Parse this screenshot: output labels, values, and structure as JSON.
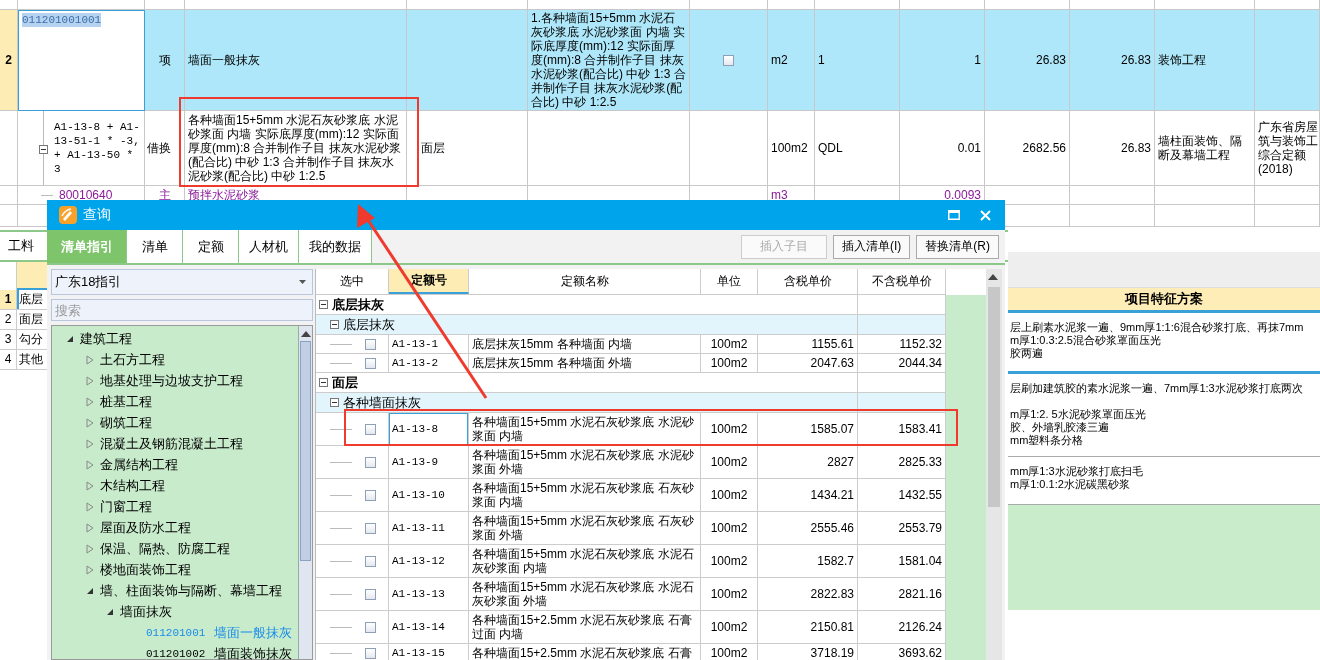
{
  "grid": {
    "rows": [
      {
        "kind": "item",
        "number": "2",
        "selected": true,
        "code": "011201001001",
        "type": "项",
        "name": "墙面一般抹灰",
        "description": "1.各种墙面15+5mm 水泥石灰砂浆底 水泥砂浆面 内墙 实际底厚度(mm):12 实际面厚度(mm):8 合并制作子目 抹灰水泥砂浆(配合比) 中砂 1:3 合并制作子目 抹灰水泥砂浆(配合比) 中砂 1:2.5",
        "checked": false,
        "unit": "m2",
        "quantity_expression": "1",
        "quantity": "1",
        "unit_price": "26.83",
        "total": "26.83",
        "category": "装饰工程"
      },
      {
        "kind": "sub",
        "expanded": true,
        "code": "A1-13-8 + A1-13-51-1 * -3,+ A1-13-50 * 3",
        "type": "借换",
        "name": "各种墙面15+5mm 水泥石灰砂浆底 水泥砂浆面 内墙 实际底厚度(mm):12 实际面厚度(mm):8 合并制作子目 抹灰水泥砂浆(配合比) 中砂 1:3 合并制作子目 抹灰水泥砂浆(配合比) 中砂 1:2.5",
        "column_5": "面层",
        "unit": "100m2",
        "quantity_expression": "QDL",
        "quantity": "0.01",
        "unit_price": "2682.56",
        "total": "26.83",
        "category": "墙柱面装饰、隔断及幕墙工程",
        "source_lines": [
          "广东省房屋",
          "筑与装饰工",
          "综合定额",
          "(2018)"
        ]
      },
      {
        "kind": "material",
        "code": "80010640",
        "type": "主",
        "name": "预拌水泥砂浆",
        "unit": "m3",
        "quantity": "0.0093"
      }
    ]
  },
  "lower_panel": {
    "tab": "工料",
    "rows": [
      {
        "number": "1",
        "name": "底层",
        "selected": true
      },
      {
        "number": "2",
        "name": "面层",
        "selected": false
      },
      {
        "number": "3",
        "name": "勾分",
        "selected": false
      },
      {
        "number": "4",
        "name": "其他",
        "selected": false
      }
    ]
  },
  "feature_panel": {
    "title": "项目特征方案",
    "sections": [
      {
        "lines": [
          "层上刷素水泥浆一遍、9mm厚1:1:6混合砂浆打底、再抹7mm",
          "m厚1:0.3:2.5混合砂浆罩面压光",
          "胶两遍"
        ]
      },
      {
        "lines": [
          "层刷加建筑胶的素水泥浆一遍、7mm厚1:3水泥砂浆打底两次",
          "m厚1:2. 5水泥砂浆罩面压光",
          "胶、外墙乳胶漆三遍",
          "mm塑料条分格"
        ]
      },
      {
        "lines": [
          "mm厚1:3水泥砂浆打底扫毛",
          "m厚1:0.1:2水泥碳黑砂浆"
        ]
      }
    ]
  },
  "dialog": {
    "title": "查询",
    "tabs": [
      {
        "label": "清单指引",
        "selected": true
      },
      {
        "label": "清单",
        "selected": false
      },
      {
        "label": "定额",
        "selected": false
      },
      {
        "label": "人材机",
        "selected": false
      },
      {
        "label": "我的数据",
        "selected": false
      }
    ],
    "buttons": [
      {
        "label": "插入子目",
        "disabled": true
      },
      {
        "label": "插入清单(I)",
        "disabled": false
      },
      {
        "label": "替换清单(R)",
        "disabled": false
      }
    ],
    "library": "广东18指引",
    "search": {
      "placeholder": "搜索"
    },
    "tree": [
      {
        "label": "建筑工程",
        "expanded": true,
        "children": [
          {
            "label": "土石方工程",
            "expanded": false
          },
          {
            "label": "地基处理与边坡支护工程",
            "expanded": false
          },
          {
            "label": "桩基工程",
            "expanded": false
          },
          {
            "label": "砌筑工程",
            "expanded": false
          },
          {
            "label": "混凝土及钢筋混凝土工程",
            "expanded": false
          },
          {
            "label": "金属结构工程",
            "expanded": false
          },
          {
            "label": "木结构工程",
            "expanded": false
          },
          {
            "label": "门窗工程",
            "expanded": false
          },
          {
            "label": "屋面及防水工程",
            "expanded": false
          },
          {
            "label": "保温、隔热、防腐工程",
            "expanded": false
          },
          {
            "label": "楼地面装饰工程",
            "expanded": false
          },
          {
            "label": "墙、柱面装饰与隔断、幕墙工程",
            "expanded": true,
            "children": [
              {
                "label": "墙面抹灰",
                "expanded": true,
                "children": [
                  {
                    "code": "011201001",
                    "label": "墙面一般抹灰",
                    "selected": true
                  },
                  {
                    "code": "011201002",
                    "label": "墙面装饰抹灰",
                    "selected": false
                  }
                ]
              }
            ]
          }
        ]
      }
    ],
    "table": {
      "columns": [
        {
          "label": "选中",
          "sorted": false
        },
        {
          "label": "定额号",
          "sorted": true
        },
        {
          "label": "定额名称",
          "sorted": false
        },
        {
          "label": "单位",
          "sorted": false
        },
        {
          "label": "含税单价",
          "sorted": false
        },
        {
          "label": "不含税单价",
          "sorted": false
        }
      ],
      "rows": [
        {
          "kind": "group",
          "label": "底层抹灰",
          "expanded": true
        },
        {
          "kind": "subgroup",
          "label": "底层抹灰",
          "expanded": true
        },
        {
          "kind": "item",
          "checked": false,
          "selected": false,
          "code": "A1-13-1",
          "name": "底层抹灰15mm 各种墙面 内墙",
          "unit": "100m2",
          "price_with_tax": "1155.61",
          "price_without_tax": "1152.32"
        },
        {
          "kind": "item",
          "checked": false,
          "selected": false,
          "code": "A1-13-2",
          "name": "底层抹灰15mm 各种墙面 外墙",
          "unit": "100m2",
          "price_with_tax": "2047.63",
          "price_without_tax": "2044.34"
        },
        {
          "kind": "group",
          "label": "面层",
          "expanded": true
        },
        {
          "kind": "subgroup",
          "label": "各种墙面抹灰",
          "expanded": true
        },
        {
          "kind": "item",
          "checked": false,
          "selected": true,
          "code": "A1-13-8",
          "name": "各种墙面15+5mm 水泥石灰砂浆底 水泥砂浆面 内墙",
          "unit": "100m2",
          "price_with_tax": "1585.07",
          "price_without_tax": "1583.41"
        },
        {
          "kind": "item",
          "checked": false,
          "selected": false,
          "code": "A1-13-9",
          "name": "各种墙面15+5mm 水泥石灰砂浆底 水泥砂浆面 外墙",
          "unit": "100m2",
          "price_with_tax": "2827",
          "price_without_tax": "2825.33"
        },
        {
          "kind": "item",
          "checked": false,
          "selected": false,
          "code": "A1-13-10",
          "name": "各种墙面15+5mm 水泥石灰砂浆底 石灰砂浆面 内墙",
          "unit": "100m2",
          "price_with_tax": "1434.21",
          "price_without_tax": "1432.55"
        },
        {
          "kind": "item",
          "checked": false,
          "selected": false,
          "code": "A1-13-11",
          "name": "各种墙面15+5mm 水泥石灰砂浆底 石灰砂浆面 外墙",
          "unit": "100m2",
          "price_with_tax": "2555.46",
          "price_without_tax": "2553.79"
        },
        {
          "kind": "item",
          "checked": false,
          "selected": false,
          "code": "A1-13-12",
          "name": "各种墙面15+5mm 水泥石灰砂浆底 水泥石灰砂浆面 内墙",
          "unit": "100m2",
          "price_with_tax": "1582.7",
          "price_without_tax": "1581.04"
        },
        {
          "kind": "item",
          "checked": false,
          "selected": false,
          "code": "A1-13-13",
          "name": "各种墙面15+5mm 水泥石灰砂浆底 水泥石灰砂浆面 外墙",
          "unit": "100m2",
          "price_with_tax": "2822.83",
          "price_without_tax": "2821.16"
        },
        {
          "kind": "item",
          "checked": false,
          "selected": false,
          "code": "A1-13-14",
          "name": "各种墙面15+2.5mm 水泥石灰砂浆底 石膏过面 内墙",
          "unit": "100m2",
          "price_with_tax": "2150.81",
          "price_without_tax": "2126.24"
        },
        {
          "kind": "item",
          "checked": false,
          "selected": false,
          "code": "A1-13-15",
          "name": "各种墙面15+2.5mm 水泥石灰砂浆底 石膏",
          "unit": "100m2",
          "price_with_tax": "3718.19",
          "price_without_tax": "3693.62"
        }
      ]
    }
  }
}
